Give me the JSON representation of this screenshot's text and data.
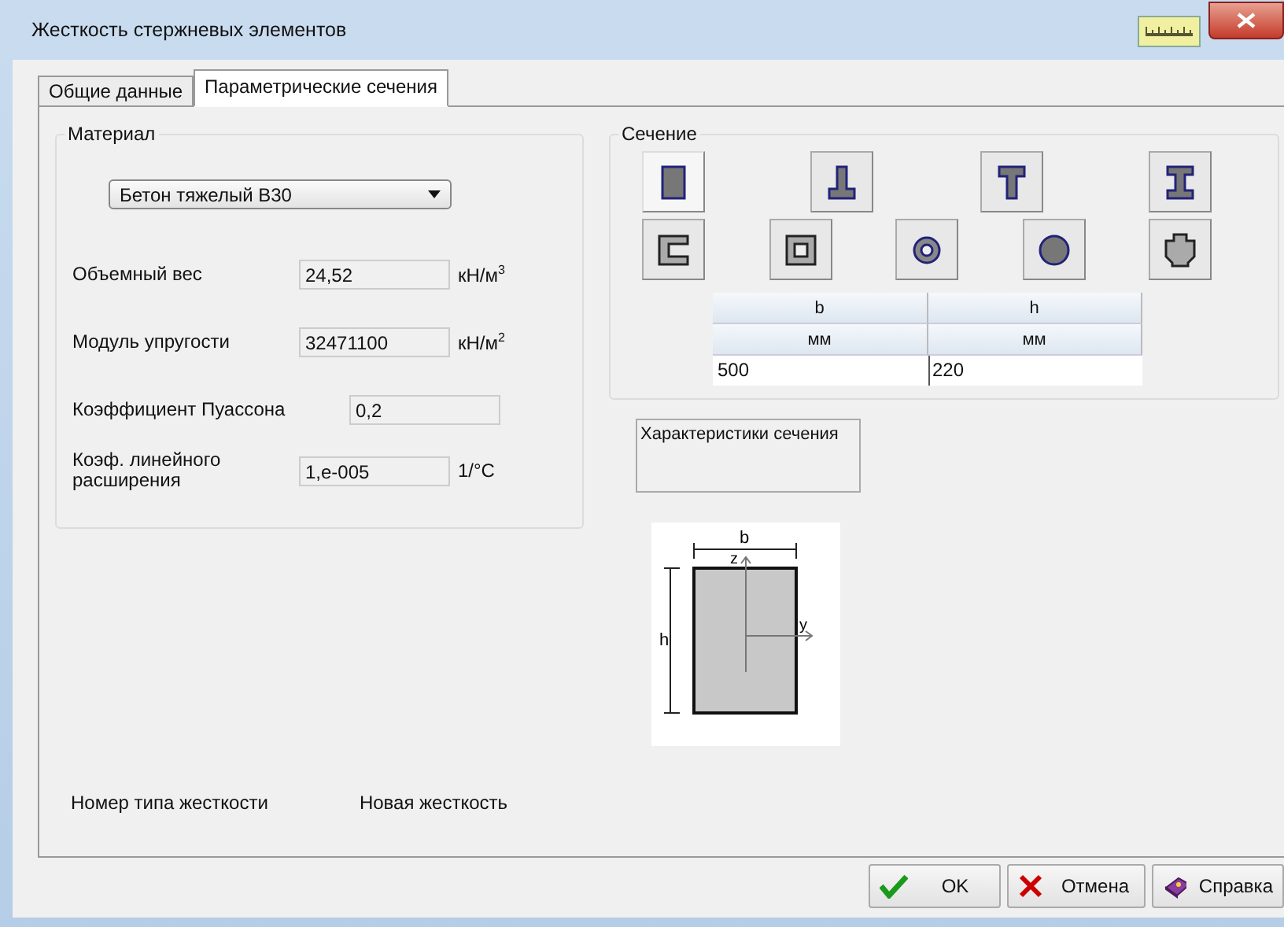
{
  "window": {
    "title": "Жесткость стержневых элементов"
  },
  "tabs": [
    {
      "label": "Общие данные",
      "selected": false
    },
    {
      "label": "Параметрические сечения",
      "selected": true
    }
  ],
  "material": {
    "title": "Материал",
    "dropdown": "Бетон тяжелый В30",
    "properties": [
      {
        "label": "Объемный вес",
        "value": "24,52",
        "unit": "кН/м$^{3}$",
        "kind": "short"
      },
      {
        "label": "Модуль упругости",
        "value": "32471100",
        "unit": "кН/м$^{2}$",
        "kind": "short"
      },
      {
        "label": "Коэффициент Пуассона",
        "value": "0,2",
        "kind": "wide"
      },
      {
        "label": "Коэф. линейного расширения",
        "value": "1,e-005",
        "unit": "1/°C",
        "kind": "short"
      }
    ]
  },
  "section": {
    "title": "Сечение",
    "shapes": [
      {
        "kind": "rect",
        "selected": true
      },
      {
        "kind": "tee_inverted",
        "selected": false
      },
      {
        "kind": "tee",
        "selected": false
      },
      {
        "kind": "ibeam",
        "selected": false
      },
      {
        "kind": "channel",
        "selected": false
      },
      {
        "kind": "box",
        "selected": false
      },
      {
        "kind": "ring",
        "selected": false
      },
      {
        "kind": "circle",
        "selected": false
      },
      {
        "kind": "cross",
        "selected": false
      }
    ],
    "table": {
      "columns": [
        {
          "name": "b",
          "unit": "мм",
          "value": "500"
        },
        {
          "name": "h",
          "unit": "мм",
          "value": "220"
        }
      ]
    }
  },
  "characteristics_button": "Характеристики сечения",
  "diagram": {
    "width_label": "b",
    "height_label": "h",
    "z_label": "z",
    "y_label": "y"
  },
  "stiffness": {
    "label": "Номер типа жесткости",
    "value": "Новая жесткость"
  },
  "buttons": [
    {
      "kind": "ok",
      "label": "OK"
    },
    {
      "kind": "cancel",
      "label": "Отмена"
    },
    {
      "kind": "help",
      "label": "Справка"
    }
  ]
}
